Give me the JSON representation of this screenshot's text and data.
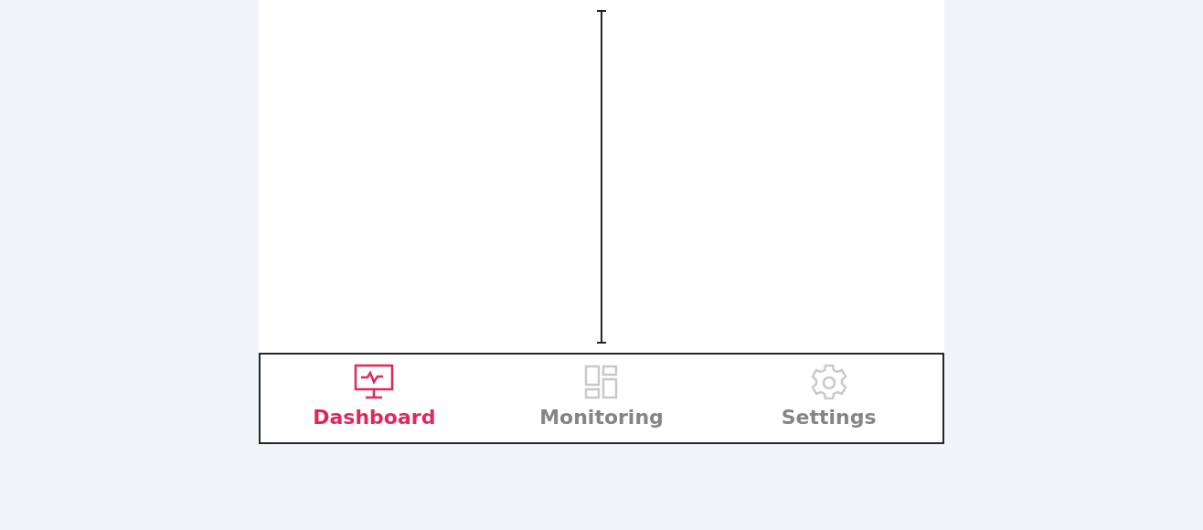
{
  "tabs": [
    {
      "label": "Dashboard",
      "kind": "monitor",
      "selected": true
    },
    {
      "label": "Monitoring",
      "kind": "grid",
      "selected": false
    },
    {
      "label": "Settings",
      "kind": "gear",
      "selected": false
    }
  ]
}
